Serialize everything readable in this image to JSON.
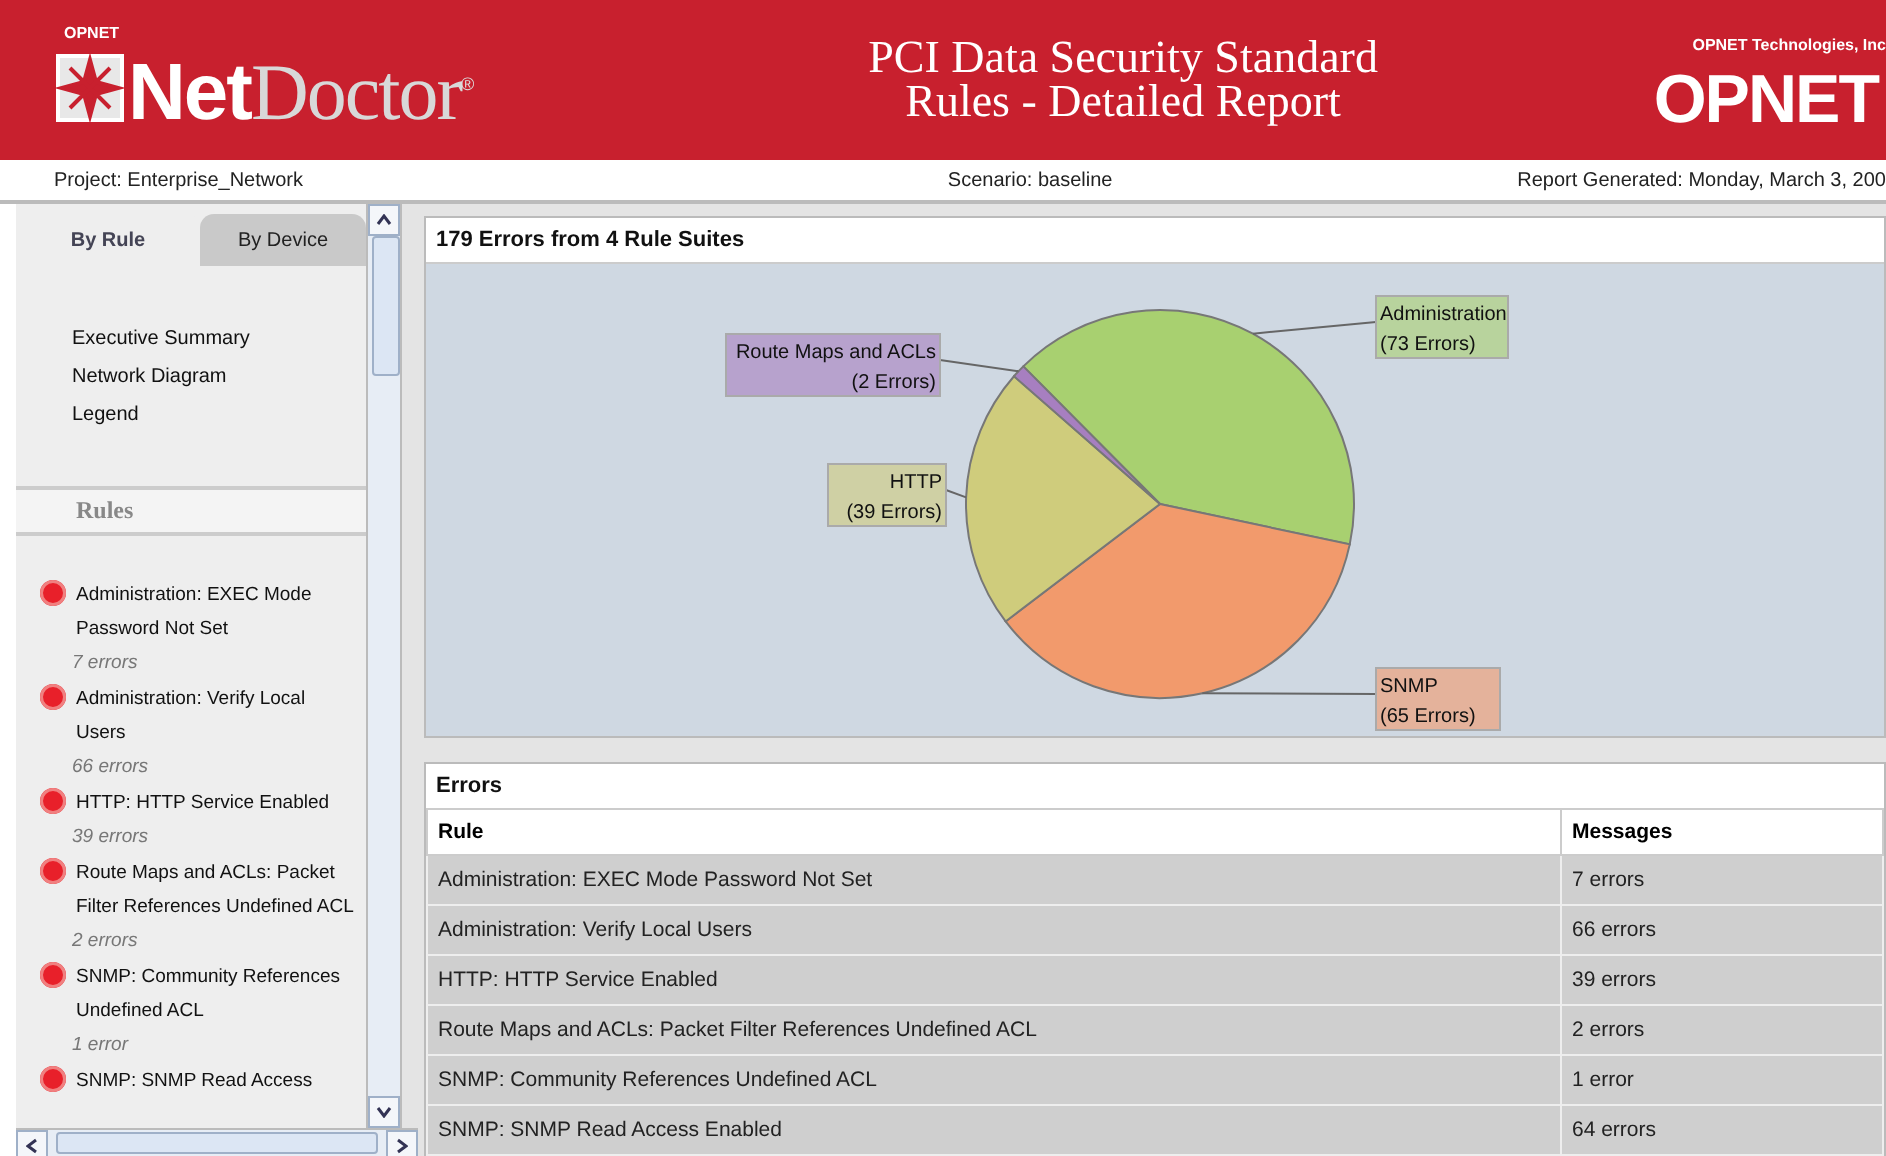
{
  "header": {
    "brand_small": "OPNET",
    "logo_bold": "Net",
    "logo_light": "Doctor",
    "logo_mark": "®",
    "title_lines": [
      "PCI Data Security Standard",
      "Rules - Detailed Report"
    ],
    "company": "OPNET Technologies, Inc",
    "company_logo": "OPNET"
  },
  "info_bar": {
    "project": "Project: Enterprise_Network",
    "scenario": "Scenario: baseline",
    "generated": "Report Generated: Monday, March 3, 200"
  },
  "sidebar": {
    "tabs": [
      {
        "label": "By Rule",
        "selected": true
      },
      {
        "label": "By Device",
        "selected": false
      }
    ],
    "links": [
      "Executive Summary",
      "Network Diagram",
      "Legend"
    ],
    "rules_heading": "Rules",
    "rules": [
      {
        "name": "Administration: EXEC Mode Password Not Set",
        "count": "7 errors"
      },
      {
        "name": "Administration: Verify Local Users",
        "count": "66 errors"
      },
      {
        "name": "HTTP: HTTP Service Enabled",
        "count": "39 errors"
      },
      {
        "name": "Route Maps and ACLs: Packet Filter References Undefined ACL",
        "count": "2 errors"
      },
      {
        "name": "SNMP: Community References Undefined ACL",
        "count": "1 error"
      },
      {
        "name": "SNMP: SNMP Read Access"
      }
    ]
  },
  "chart_panel": {
    "chart_data": {
      "type": "pie",
      "title": "179 Errors from 4 Rule Suites",
      "categories": [
        "Administration",
        "SNMP",
        "HTTP",
        "Route Maps and ACLs"
      ],
      "values": [
        73,
        65,
        39,
        2
      ],
      "colors": [
        "#a8d070",
        "#f29a6c",
        "#cfcc7c",
        "#a77fc0"
      ],
      "value_labels": [
        "(73 Errors)",
        "(65 Errors)",
        "(39 Errors)",
        "(2 Errors)"
      ]
    }
  },
  "errors_table": {
    "title": "Errors",
    "columns": [
      "Rule",
      "Messages"
    ],
    "rows": [
      [
        "Administration: EXEC Mode Password Not Set",
        "7 errors"
      ],
      [
        "Administration: Verify Local Users",
        "66 errors"
      ],
      [
        "HTTP: HTTP Service Enabled",
        "39 errors"
      ],
      [
        "Route Maps and ACLs: Packet Filter References Undefined ACL",
        "2 errors"
      ],
      [
        "SNMP: Community References Undefined ACL",
        "1 error"
      ],
      [
        "SNMP: SNMP Read Access Enabled",
        "64 errors"
      ]
    ]
  }
}
